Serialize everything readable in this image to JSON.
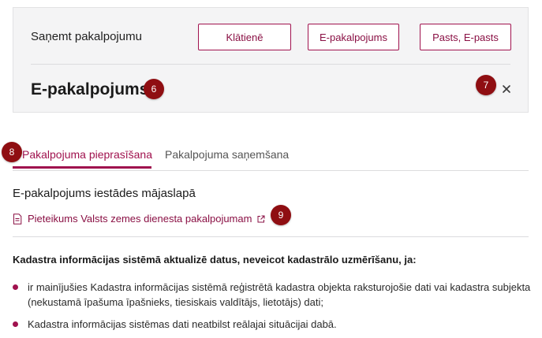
{
  "service_panel": {
    "receive_label": "Saņemt pakalpojumu",
    "mode_buttons": [
      "Klātienē",
      "E-pakalpojums",
      "Pasts, E-pasts"
    ],
    "selected_title": "E-pakalpojums",
    "close_icon": "close-icon"
  },
  "markers": [
    "6",
    "7",
    "8",
    "9"
  ],
  "tabs": [
    "Pakalpojuma pieprasīšana",
    "Pakalpojuma saņemšana"
  ],
  "content": {
    "heading": "E-pakalpojums iestādes mājaslapā",
    "link_text": "Pieteikums Valsts zemes dienesta pakalpojumam",
    "intro": "Kadastra informācijas sistēmā aktualizē datus, neveicot kadastrālo uzmērīšanu, ja:",
    "bullets": [
      "ir mainījušies Kadastra informācijas sistēmā reģistrētā kadastra objekta raksturojošie dati vai kadastra subjekta (nekustamā īpašuma īpašnieks, tiesiskais valdītājs, lietotājs) dati;",
      "Kadastra informācijas sistēmas dati neatbilst reālajai situācijai dabā."
    ]
  },
  "colors": {
    "accent": "#a0124e",
    "marker": "#8f0e12",
    "panel_bg": "#f4f4f5"
  }
}
